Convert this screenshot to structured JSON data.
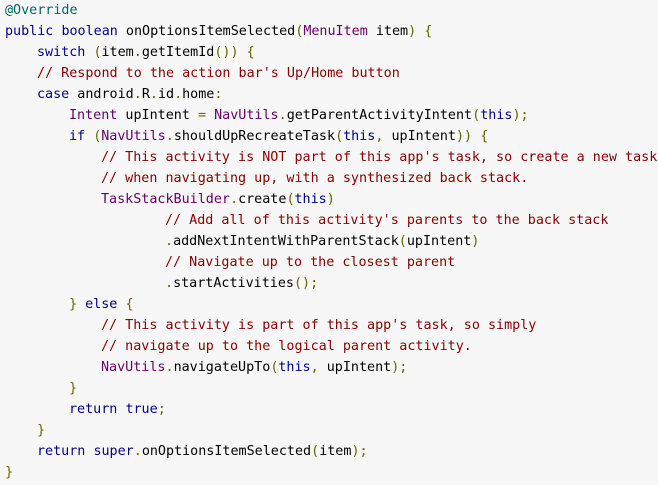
{
  "code": {
    "lines": [
      {
        "indent": 0,
        "tokens": [
          {
            "k": "annotation",
            "t": "@Override"
          }
        ]
      },
      {
        "indent": 0,
        "tokens": [
          {
            "k": "keyword",
            "t": "public"
          },
          {
            "k": "plain",
            "t": " "
          },
          {
            "k": "keyword",
            "t": "boolean"
          },
          {
            "k": "plain",
            "t": " onOptionsItemSelected"
          },
          {
            "k": "punct",
            "t": "("
          },
          {
            "k": "type",
            "t": "MenuItem"
          },
          {
            "k": "plain",
            "t": " item"
          },
          {
            "k": "punct",
            "t": ")"
          },
          {
            "k": "plain",
            "t": " "
          },
          {
            "k": "punct",
            "t": "{"
          }
        ]
      },
      {
        "indent": 1,
        "tokens": [
          {
            "k": "keyword",
            "t": "switch"
          },
          {
            "k": "plain",
            "t": " "
          },
          {
            "k": "punct",
            "t": "("
          },
          {
            "k": "plain",
            "t": "item"
          },
          {
            "k": "punct",
            "t": "."
          },
          {
            "k": "plain",
            "t": "getItemId"
          },
          {
            "k": "punct",
            "t": "())"
          },
          {
            "k": "plain",
            "t": " "
          },
          {
            "k": "punct",
            "t": "{"
          }
        ]
      },
      {
        "indent": 1,
        "tokens": [
          {
            "k": "comment",
            "t": "// Respond to the action bar's Up/Home button"
          }
        ]
      },
      {
        "indent": 1,
        "tokens": [
          {
            "k": "keyword",
            "t": "case"
          },
          {
            "k": "plain",
            "t": " android"
          },
          {
            "k": "punct",
            "t": "."
          },
          {
            "k": "plain",
            "t": "R"
          },
          {
            "k": "punct",
            "t": "."
          },
          {
            "k": "plain",
            "t": "id"
          },
          {
            "k": "punct",
            "t": "."
          },
          {
            "k": "plain",
            "t": "home"
          },
          {
            "k": "punct",
            "t": ":"
          }
        ]
      },
      {
        "indent": 2,
        "tokens": [
          {
            "k": "type",
            "t": "Intent"
          },
          {
            "k": "plain",
            "t": " upIntent "
          },
          {
            "k": "punct",
            "t": "="
          },
          {
            "k": "plain",
            "t": " "
          },
          {
            "k": "type",
            "t": "NavUtils"
          },
          {
            "k": "punct",
            "t": "."
          },
          {
            "k": "plain",
            "t": "getParentActivityIntent"
          },
          {
            "k": "punct",
            "t": "("
          },
          {
            "k": "keyword",
            "t": "this"
          },
          {
            "k": "punct",
            "t": ");"
          }
        ]
      },
      {
        "indent": 2,
        "tokens": [
          {
            "k": "keyword",
            "t": "if"
          },
          {
            "k": "plain",
            "t": " "
          },
          {
            "k": "punct",
            "t": "("
          },
          {
            "k": "type",
            "t": "NavUtils"
          },
          {
            "k": "punct",
            "t": "."
          },
          {
            "k": "plain",
            "t": "shouldUpRecreateTask"
          },
          {
            "k": "punct",
            "t": "("
          },
          {
            "k": "keyword",
            "t": "this"
          },
          {
            "k": "punct",
            "t": ","
          },
          {
            "k": "plain",
            "t": " upIntent"
          },
          {
            "k": "punct",
            "t": "))"
          },
          {
            "k": "plain",
            "t": " "
          },
          {
            "k": "punct",
            "t": "{"
          }
        ]
      },
      {
        "indent": 3,
        "tokens": [
          {
            "k": "comment",
            "t": "// This activity is NOT part of this app's task, so create a new task"
          }
        ]
      },
      {
        "indent": 3,
        "tokens": [
          {
            "k": "comment",
            "t": "// when navigating up, with a synthesized back stack."
          }
        ]
      },
      {
        "indent": 3,
        "tokens": [
          {
            "k": "type",
            "t": "TaskStackBuilder"
          },
          {
            "k": "punct",
            "t": "."
          },
          {
            "k": "plain",
            "t": "create"
          },
          {
            "k": "punct",
            "t": "("
          },
          {
            "k": "keyword",
            "t": "this"
          },
          {
            "k": "punct",
            "t": ")"
          }
        ]
      },
      {
        "indent": 5,
        "tokens": [
          {
            "k": "comment",
            "t": "// Add all of this activity's parents to the back stack"
          }
        ]
      },
      {
        "indent": 5,
        "tokens": [
          {
            "k": "punct",
            "t": "."
          },
          {
            "k": "plain",
            "t": "addNextIntentWithParentStack"
          },
          {
            "k": "punct",
            "t": "("
          },
          {
            "k": "plain",
            "t": "upIntent"
          },
          {
            "k": "punct",
            "t": ")"
          }
        ]
      },
      {
        "indent": 5,
        "tokens": [
          {
            "k": "comment",
            "t": "// Navigate up to the closest parent"
          }
        ]
      },
      {
        "indent": 5,
        "tokens": [
          {
            "k": "punct",
            "t": "."
          },
          {
            "k": "plain",
            "t": "startActivities"
          },
          {
            "k": "punct",
            "t": "();"
          }
        ]
      },
      {
        "indent": 2,
        "tokens": [
          {
            "k": "punct",
            "t": "}"
          },
          {
            "k": "plain",
            "t": " "
          },
          {
            "k": "keyword",
            "t": "else"
          },
          {
            "k": "plain",
            "t": " "
          },
          {
            "k": "punct",
            "t": "{"
          }
        ]
      },
      {
        "indent": 3,
        "tokens": [
          {
            "k": "comment",
            "t": "// This activity is part of this app's task, so simply"
          }
        ]
      },
      {
        "indent": 3,
        "tokens": [
          {
            "k": "comment",
            "t": "// navigate up to the logical parent activity."
          }
        ]
      },
      {
        "indent": 3,
        "tokens": [
          {
            "k": "type",
            "t": "NavUtils"
          },
          {
            "k": "punct",
            "t": "."
          },
          {
            "k": "plain",
            "t": "navigateUpTo"
          },
          {
            "k": "punct",
            "t": "("
          },
          {
            "k": "keyword",
            "t": "this"
          },
          {
            "k": "punct",
            "t": ","
          },
          {
            "k": "plain",
            "t": " upIntent"
          },
          {
            "k": "punct",
            "t": ");"
          }
        ]
      },
      {
        "indent": 2,
        "tokens": [
          {
            "k": "punct",
            "t": "}"
          }
        ]
      },
      {
        "indent": 2,
        "tokens": [
          {
            "k": "keyword",
            "t": "return"
          },
          {
            "k": "plain",
            "t": " "
          },
          {
            "k": "keyword",
            "t": "true"
          },
          {
            "k": "punct",
            "t": ";"
          }
        ]
      },
      {
        "indent": 1,
        "tokens": [
          {
            "k": "punct",
            "t": "}"
          }
        ]
      },
      {
        "indent": 1,
        "tokens": [
          {
            "k": "keyword",
            "t": "return"
          },
          {
            "k": "plain",
            "t": " "
          },
          {
            "k": "keyword",
            "t": "super"
          },
          {
            "k": "punct",
            "t": "."
          },
          {
            "k": "plain",
            "t": "onOptionsItemSelected"
          },
          {
            "k": "punct",
            "t": "("
          },
          {
            "k": "plain",
            "t": "item"
          },
          {
            "k": "punct",
            "t": ");"
          }
        ]
      },
      {
        "indent": 0,
        "tokens": [
          {
            "k": "punct",
            "t": "}"
          }
        ]
      }
    ]
  },
  "colors": {
    "background": "#f7f7f7",
    "annotation": "#006666",
    "keyword": "#000088",
    "type": "#660066",
    "plain": "#000000",
    "punct": "#666600",
    "comment": "#880000"
  }
}
